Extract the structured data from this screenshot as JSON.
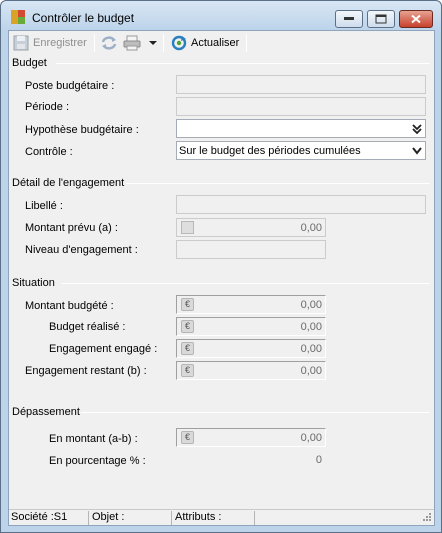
{
  "window": {
    "title": "Contrôler le budget"
  },
  "toolbar": {
    "save_label": "Enregistrer",
    "refresh_label": "Actualiser",
    "icons": [
      "save-icon",
      "sync-icon",
      "printer-icon",
      "dropdown-arrow-icon",
      "refresh-icon"
    ]
  },
  "budget": {
    "section": "Budget",
    "poste_label": "Poste budgétaire :",
    "poste_value": "",
    "periode_label": "Période :",
    "periode_value": "",
    "hypothese_label": "Hypothèse budgétaire :",
    "hypothese_value": "",
    "controle_label": "Contrôle :",
    "controle_value": "Sur le budget des périodes cumulées"
  },
  "engagement": {
    "section": "Détail de l'engagement",
    "libelle_label": "Libellé :",
    "libelle_value": "",
    "montant_label": "Montant prévu  (a) :",
    "montant_value": "0,00",
    "niveau_label": "Niveau d'engagement :",
    "niveau_value": ""
  },
  "situation": {
    "section": "Situation",
    "budgete_label": "Montant budgété :",
    "budgete_value": "0,00",
    "realise_label": "Budget réalisé :",
    "realise_value": "0,00",
    "engage_label": "Engagement engagé :",
    "engage_value": "0,00",
    "restant_label": "Engagement restant  (b) :",
    "restant_value": "0,00"
  },
  "depassement": {
    "section": "Dépassement",
    "montant_label": "En montant  (a-b) :",
    "montant_value": "0,00",
    "pourcentage_label": "En pourcentage  % :",
    "pourcentage_value": "0"
  },
  "status": {
    "societe": "Société :S1",
    "objet": "Objet :",
    "attributs": "Attributs :"
  },
  "colors": {
    "title_bar": "#bcd3ea",
    "close_button": "#c6412c",
    "dialog_bg": "#f0f0f0"
  }
}
